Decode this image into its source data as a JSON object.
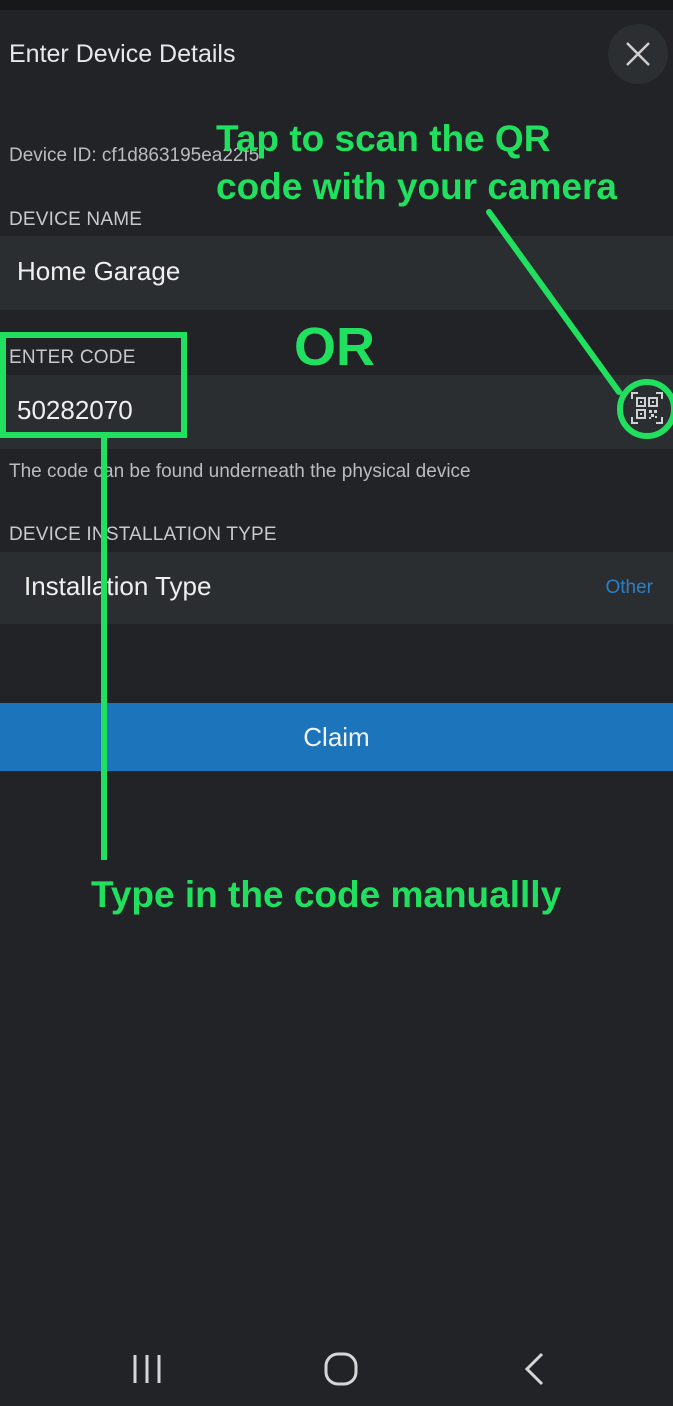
{
  "header": {
    "title": "Enter Device Details",
    "close_icon": "close-icon"
  },
  "device": {
    "id_text": "Device ID: cf1d863195ea22f5"
  },
  "device_name": {
    "label": "DEVICE NAME",
    "value": "Home Garage"
  },
  "code": {
    "label": "ENTER CODE",
    "value": "50282070",
    "qr_icon": "qr-code-icon",
    "hint": "The code can be found underneath the physical device"
  },
  "installation": {
    "label": "DEVICE INSTALLATION TYPE",
    "title": "Installation Type",
    "value": "Other"
  },
  "claim_button": "Claim",
  "annotations": {
    "scan_line1": "Tap to scan the QR",
    "scan_line2": "code with your camera",
    "or": "OR",
    "manual": "Type in the code manuallly",
    "color": "#22e05f"
  },
  "navbar": {
    "recents_icon": "recents-icon",
    "home_icon": "home-icon",
    "back_icon": "back-icon"
  }
}
